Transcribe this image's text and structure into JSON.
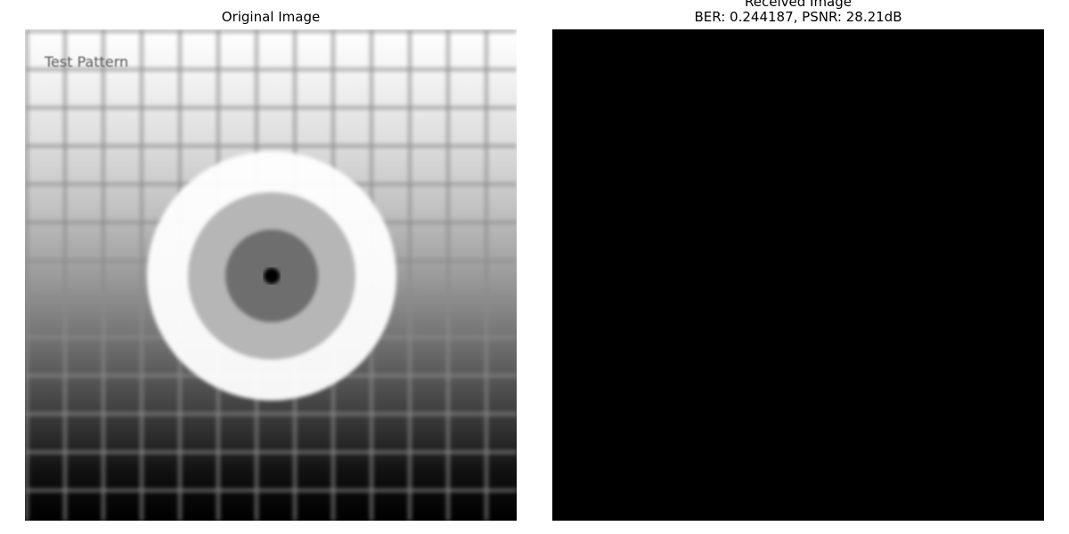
{
  "panels": {
    "original": {
      "title": "Original Image",
      "pattern_text": "Test Pattern"
    },
    "received": {
      "title_line1": "Received Image",
      "title_line2": "BER: 0.244187, PSNR: 28.21dB",
      "fill_color": "#000000"
    }
  }
}
